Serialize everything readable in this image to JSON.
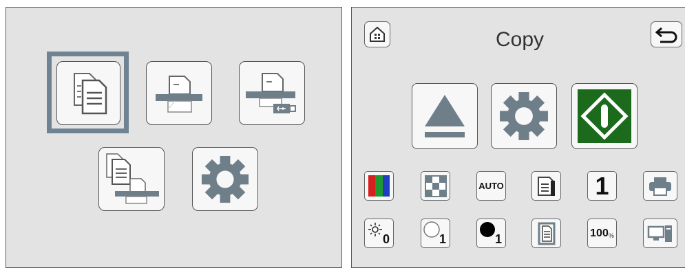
{
  "left_menu": {
    "buttons": [
      {
        "icon": "copy-icon"
      },
      {
        "icon": "scan-icon"
      },
      {
        "icon": "scan-to-usb-icon"
      },
      {
        "icon": "copy-scan-icon"
      },
      {
        "icon": "gear-icon"
      }
    ]
  },
  "copy_screen": {
    "title": "Copy",
    "home_icon": "home-icon",
    "back_icon": "back-arrow-icon",
    "main_buttons": [
      {
        "icon": "eject-icon"
      },
      {
        "icon": "gear-icon"
      },
      {
        "icon": "start-icon",
        "color": "#1c6b1c"
      }
    ],
    "row1": [
      {
        "icon": "color-mode-icon"
      },
      {
        "icon": "quality-grid-icon"
      },
      {
        "label": "AUTO"
      },
      {
        "icon": "duplex-icon"
      },
      {
        "label": "1"
      },
      {
        "icon": "printer-icon"
      }
    ],
    "row2": [
      {
        "icon": "brightness-icon",
        "label": "0"
      },
      {
        "icon": "contrast-light-icon",
        "label": "1"
      },
      {
        "icon": "contrast-dark-icon",
        "label": "1"
      },
      {
        "icon": "page-layout-icon"
      },
      {
        "label": "100",
        "suffix": "%"
      },
      {
        "icon": "device-icon"
      }
    ]
  }
}
